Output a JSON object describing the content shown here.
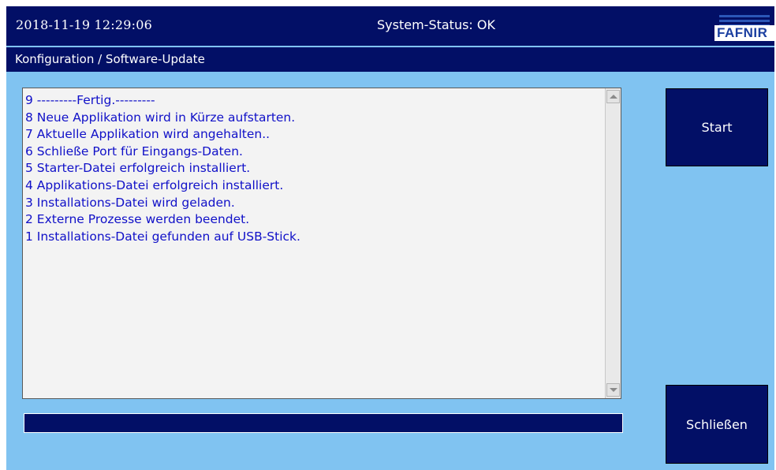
{
  "header": {
    "datetime": "2018-11-19  12:29:06",
    "system_status": "System-Status: OK",
    "logo_text": "FAFNIR"
  },
  "subheader": {
    "title": "Konfiguration / Software-Update"
  },
  "log": {
    "lines": [
      "9 ---------Fertig.---------",
      "8 Neue Applikation wird in Kürze aufstarten.",
      "7 Aktuelle Applikation wird angehalten..",
      "6 Schließe Port für Eingangs-Daten.",
      "5 Starter-Datei erfolgreich installiert.",
      "4 Applikations-Datei erfolgreich installiert.",
      "3 Installations-Datei wird geladen.",
      "2 Externe Prozesse werden beendet.",
      "1 Installations-Datei gefunden auf USB-Stick."
    ]
  },
  "progress": {
    "value": 1.0
  },
  "buttons": {
    "start_label": "Start",
    "close_label": "Schließen"
  },
  "colors": {
    "navy": "#020f66",
    "background": "#80c3f1",
    "log_text": "#1010c8"
  }
}
